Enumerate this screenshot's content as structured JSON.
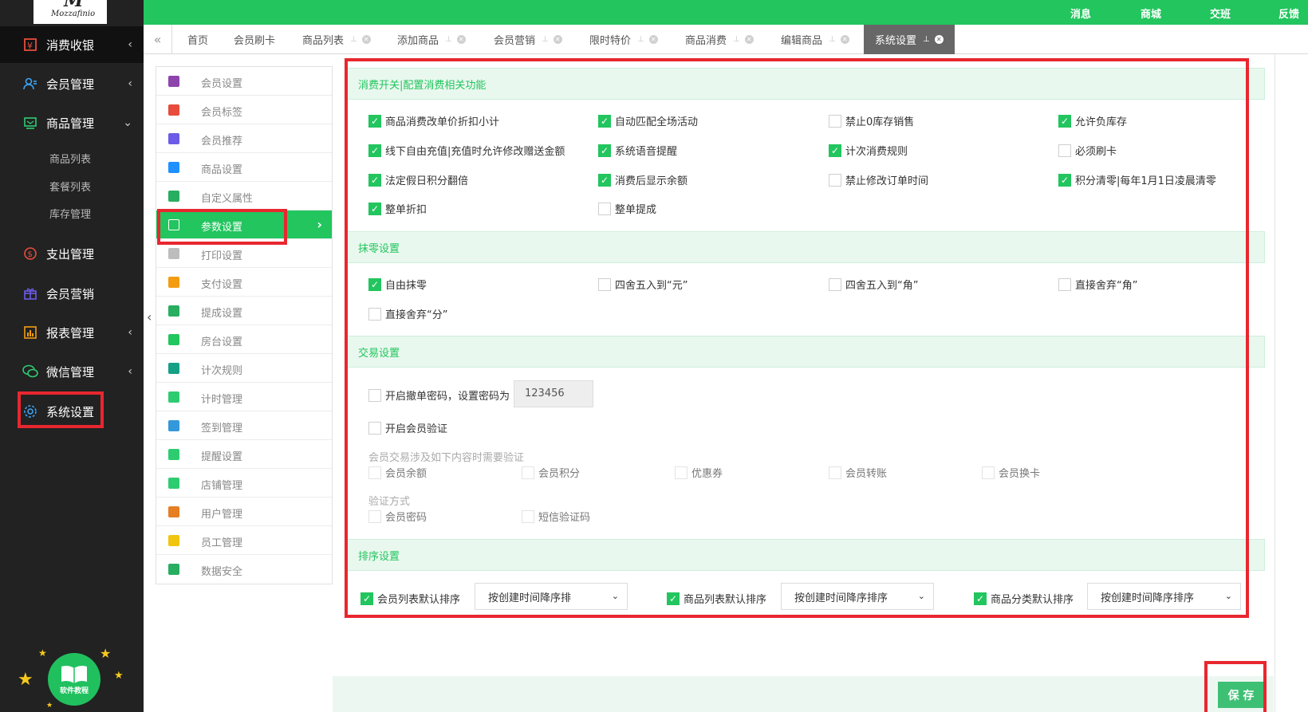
{
  "brand": {
    "logo_text": "Mozzafinio",
    "logo_mark": "M"
  },
  "topbar": {
    "links": [
      "消息",
      "商城",
      "交班",
      "反馈"
    ]
  },
  "leftnav": {
    "items": [
      {
        "label": "消费收银",
        "icon": "cashier-icon",
        "arrow": "‹"
      },
      {
        "label": "会员管理",
        "icon": "member-icon",
        "arrow": "‹"
      },
      {
        "label": "商品管理",
        "icon": "goods-icon",
        "arrow": "⌄"
      },
      {
        "label": "支出管理",
        "icon": "expense-icon",
        "arrow": ""
      },
      {
        "label": "会员营销",
        "icon": "gift-icon",
        "arrow": ""
      },
      {
        "label": "报表管理",
        "icon": "report-icon",
        "arrow": "‹"
      },
      {
        "label": "微信管理",
        "icon": "wechat-icon",
        "arrow": "‹"
      },
      {
        "label": "系统设置",
        "icon": "gear-icon",
        "arrow": ""
      }
    ],
    "sub_items": [
      "商品列表",
      "套餐列表",
      "库存管理"
    ],
    "tutorial_label": "软件教程"
  },
  "tabs": [
    {
      "label": "首页"
    },
    {
      "label": "会员刷卡"
    },
    {
      "label": "商品列表"
    },
    {
      "label": "添加商品"
    },
    {
      "label": "会员营销"
    },
    {
      "label": "限时特价"
    },
    {
      "label": "商品消费"
    },
    {
      "label": "编辑商品"
    },
    {
      "label": "系统设置"
    }
  ],
  "submenu": [
    {
      "label": "会员设置",
      "color": "#8e44ad"
    },
    {
      "label": "会员标签",
      "color": "#e74c3c"
    },
    {
      "label": "会员推荐",
      "color": "#6c5ce7"
    },
    {
      "label": "商品设置",
      "color": "#1e90ff"
    },
    {
      "label": "自定义属性",
      "color": "#27ae60"
    },
    {
      "label": "参数设置",
      "color": "#ffffff"
    },
    {
      "label": "打印设置",
      "color": "#bdbdbd"
    },
    {
      "label": "支付设置",
      "color": "#f39c12"
    },
    {
      "label": "提成设置",
      "color": "#27ae60"
    },
    {
      "label": "房台设置",
      "color": "#22c55e"
    },
    {
      "label": "计次规则",
      "color": "#16a085"
    },
    {
      "label": "计时管理",
      "color": "#2ecc71"
    },
    {
      "label": "签到管理",
      "color": "#3498db"
    },
    {
      "label": "提醒设置",
      "color": "#2ecc71"
    },
    {
      "label": "店铺管理",
      "color": "#2ecc71"
    },
    {
      "label": "用户管理",
      "color": "#e67e22"
    },
    {
      "label": "员工管理",
      "color": "#f1c40f"
    },
    {
      "label": "数据安全",
      "color": "#27ae60"
    }
  ],
  "sections": {
    "consume": {
      "title": "消费开关|配置消费相关功能",
      "options": [
        {
          "label": "商品消费改单价折扣小计",
          "checked": true
        },
        {
          "label": "自动匹配全场活动",
          "checked": true
        },
        {
          "label": "禁止0库存销售",
          "checked": false
        },
        {
          "label": "允许负库存",
          "checked": true
        },
        {
          "label": "线下自由充值|充值时允许修改赠送金额",
          "checked": true
        },
        {
          "label": "系统语音提醒",
          "checked": true
        },
        {
          "label": "计次消费规则",
          "checked": true
        },
        {
          "label": "必须刷卡",
          "checked": false
        },
        {
          "label": "法定假日积分翻倍",
          "checked": true
        },
        {
          "label": "消费后显示余额",
          "checked": true
        },
        {
          "label": "禁止修改订单时间",
          "checked": false
        },
        {
          "label": "积分清零|每年1月1日凌晨清零",
          "checked": true
        },
        {
          "label": "整单折扣",
          "checked": true
        },
        {
          "label": "整单提成",
          "checked": false
        }
      ]
    },
    "rounding": {
      "title": "抹零设置",
      "options": [
        {
          "label": "自由抹零",
          "checked": true
        },
        {
          "label": "四舍五入到“元”",
          "checked": false
        },
        {
          "label": "四舍五入到“角”",
          "checked": false
        },
        {
          "label": "直接舍弃“角”",
          "checked": false
        },
        {
          "label": "直接舍弃“分”",
          "checked": false
        }
      ]
    },
    "trade": {
      "title": "交易设置",
      "cancel_pwd_label": "开启撤单密码，设置密码为",
      "cancel_pwd_value": "123456",
      "member_verify_label": "开启会员验证",
      "verify_items_note": "会员交易涉及如下内容时需要验证",
      "verify_items": [
        "会员余额",
        "会员积分",
        "优惠券",
        "会员转账",
        "会员换卡"
      ],
      "verify_method_note": "验证方式",
      "verify_methods": [
        "会员密码",
        "短信验证码"
      ]
    },
    "sort": {
      "title": "排序设置",
      "rows": [
        {
          "label": "会员列表默认排序",
          "checked": true,
          "value": "按创建时间降序排"
        },
        {
          "label": "商品列表默认排序",
          "checked": true,
          "value": "按创建时间降序排序"
        },
        {
          "label": "商品分类默认排序",
          "checked": true,
          "value": "按创建时间降序排序"
        }
      ]
    }
  },
  "save_label": "保 存",
  "colors": {
    "accent": "#22c55e",
    "highlight": "#e8272f",
    "nav_bg": "#222222"
  }
}
